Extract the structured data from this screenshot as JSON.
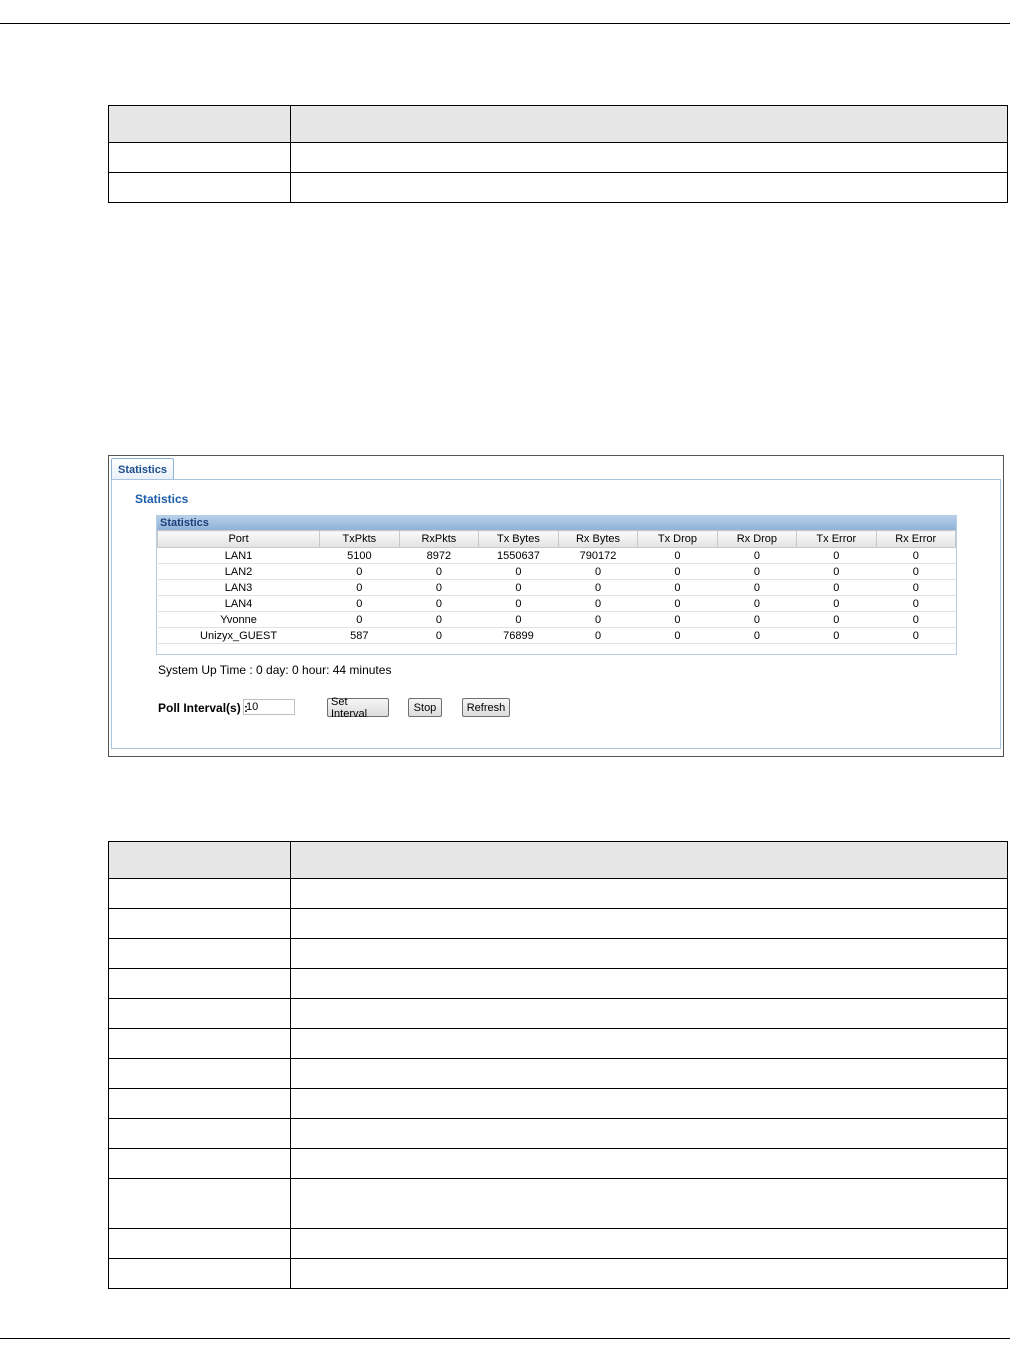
{
  "tab": {
    "label": "Statistics"
  },
  "panel": {
    "title": "Statistics"
  },
  "stats": {
    "header": "Statistics",
    "columns": [
      "Port",
      "TxPkts",
      "RxPkts",
      "Tx Bytes",
      "Rx Bytes",
      "Tx Drop",
      "Rx Drop",
      "Tx Error",
      "Rx Error"
    ],
    "rows": [
      [
        "LAN1",
        "5100",
        "8972",
        "1550637",
        "790172",
        "0",
        "0",
        "0",
        "0"
      ],
      [
        "LAN2",
        "0",
        "0",
        "0",
        "0",
        "0",
        "0",
        "0",
        "0"
      ],
      [
        "LAN3",
        "0",
        "0",
        "0",
        "0",
        "0",
        "0",
        "0",
        "0"
      ],
      [
        "LAN4",
        "0",
        "0",
        "0",
        "0",
        "0",
        "0",
        "0",
        "0"
      ],
      [
        "Yvonne",
        "0",
        "0",
        "0",
        "0",
        "0",
        "0",
        "0",
        "0"
      ],
      [
        "Unizyx_GUEST",
        "587",
        "0",
        "76899",
        "0",
        "0",
        "0",
        "0",
        "0"
      ]
    ]
  },
  "uptime": "System Up Time : 0 day: 0 hour: 44 minutes",
  "poll": {
    "label": "Poll Interval(s) :",
    "value": "10"
  },
  "buttons": {
    "set_interval": "Set Interval",
    "stop": "Stop",
    "refresh": "Refresh"
  }
}
